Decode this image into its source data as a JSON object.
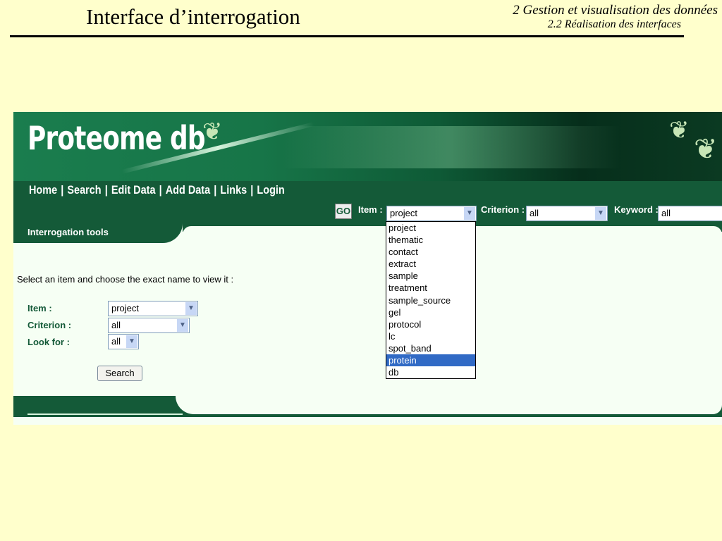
{
  "slide": {
    "title": "Interface d’interrogation",
    "section": "2 Gestion et visualisation des données",
    "subsection": "2.2 Réalisation des interfaces"
  },
  "app": {
    "logo": "Proteome db",
    "nav": [
      "Home",
      "Search",
      "Edit Data",
      "Add Data",
      "Links",
      "Login"
    ],
    "nav_separator": "|"
  },
  "quick_search": {
    "go_label": "GO",
    "item_label": "Item :",
    "item_value": "project",
    "criterion_label": "Criterion :",
    "criterion_value": "all",
    "keyword_label": "Keyword :",
    "keyword_value": "all"
  },
  "item_dropdown": {
    "options": [
      "project",
      "thematic",
      "contact",
      "extract",
      "sample",
      "treatment",
      "sample_source",
      "gel",
      "protocol",
      "lc",
      "spot_band",
      "protein",
      "db"
    ],
    "highlighted": "protein"
  },
  "panel": {
    "tab_label": "Interrogation tools",
    "intro": "Select an item and choose the exact name to view it :",
    "item_label": "Item :",
    "item_value": "project",
    "criterion_label": "Criterion :",
    "criterion_value": "all",
    "lookfor_label": "Look for :",
    "lookfor_value": "all",
    "search_button": "Search"
  },
  "colors": {
    "slide_bg": "#ffffcc",
    "brand_green": "#145a38",
    "highlight": "#316ac5"
  }
}
